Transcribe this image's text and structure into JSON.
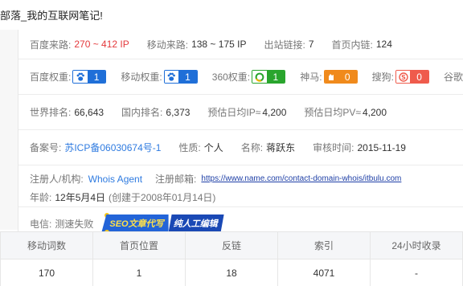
{
  "title": "部落_我的互联网笔记!",
  "traffic": {
    "baidu_label": "百度来路:",
    "baidu_value": "270 ~ 412 IP",
    "mobile_label": "移动来路:",
    "mobile_value": "138 ~ 175 IP",
    "outlinks_label": "出站链接:",
    "outlinks_value": "7",
    "homepage_links_label": "首页内链:",
    "homepage_links_value": "124"
  },
  "weights": {
    "baidu_label": "百度权重:",
    "baidu_value": "1",
    "mobile_label": "移动权重:",
    "mobile_value": "1",
    "s360_label": "360权重:",
    "s360_value": "1",
    "shenma_label": "神马:",
    "shenma_value": "0",
    "sogou_label": "搜狗:",
    "sogou_value": "0",
    "google_label": "谷歌"
  },
  "rank": {
    "world_label": "世界排名:",
    "world_value": "66,643",
    "domestic_label": "国内排名:",
    "domestic_value": "6,373",
    "ip_label": "预估日均IP≈",
    "ip_value": "4,200",
    "pv_label": "预估日均PV≈",
    "pv_value": "4,200"
  },
  "icp": {
    "record_label": "备案号:",
    "record_value": "苏ICP备06030674号-1",
    "nature_label": "性质:",
    "nature_value": "个人",
    "name_label": "名称:",
    "name_value": "蒋跃东",
    "audit_label": "审核时间:",
    "audit_value": "2015-11-19"
  },
  "whois": {
    "registrant_label": "注册人/机构:",
    "registrant_value": "Whois Agent",
    "email_label": "注册邮箱:",
    "email_value": "https://www.name.com/contact-domain-whois/itbulu.com",
    "age_label": "年龄:",
    "age_value": "12年5月4日",
    "age_note": "(创建于2008年01月14日)"
  },
  "phone": {
    "label": "电信:",
    "value": "测速失败"
  },
  "promo": {
    "part1": "SEO文章代写",
    "part2": "纯人工编辑"
  },
  "stats": {
    "headers": [
      "移动词数",
      "首页位置",
      "反链",
      "索引",
      "24小时收录"
    ],
    "values": [
      "170",
      "1",
      "18",
      "4071",
      "-"
    ]
  },
  "colors": {
    "baidu_blue": "#1f6fd8",
    "s360_green": "#29a52d",
    "shenma_orange": "#f08a1c",
    "sogou_red": "#ef5b4c",
    "ip_red": "#e4393c",
    "link_blue": "#2f7be0"
  }
}
